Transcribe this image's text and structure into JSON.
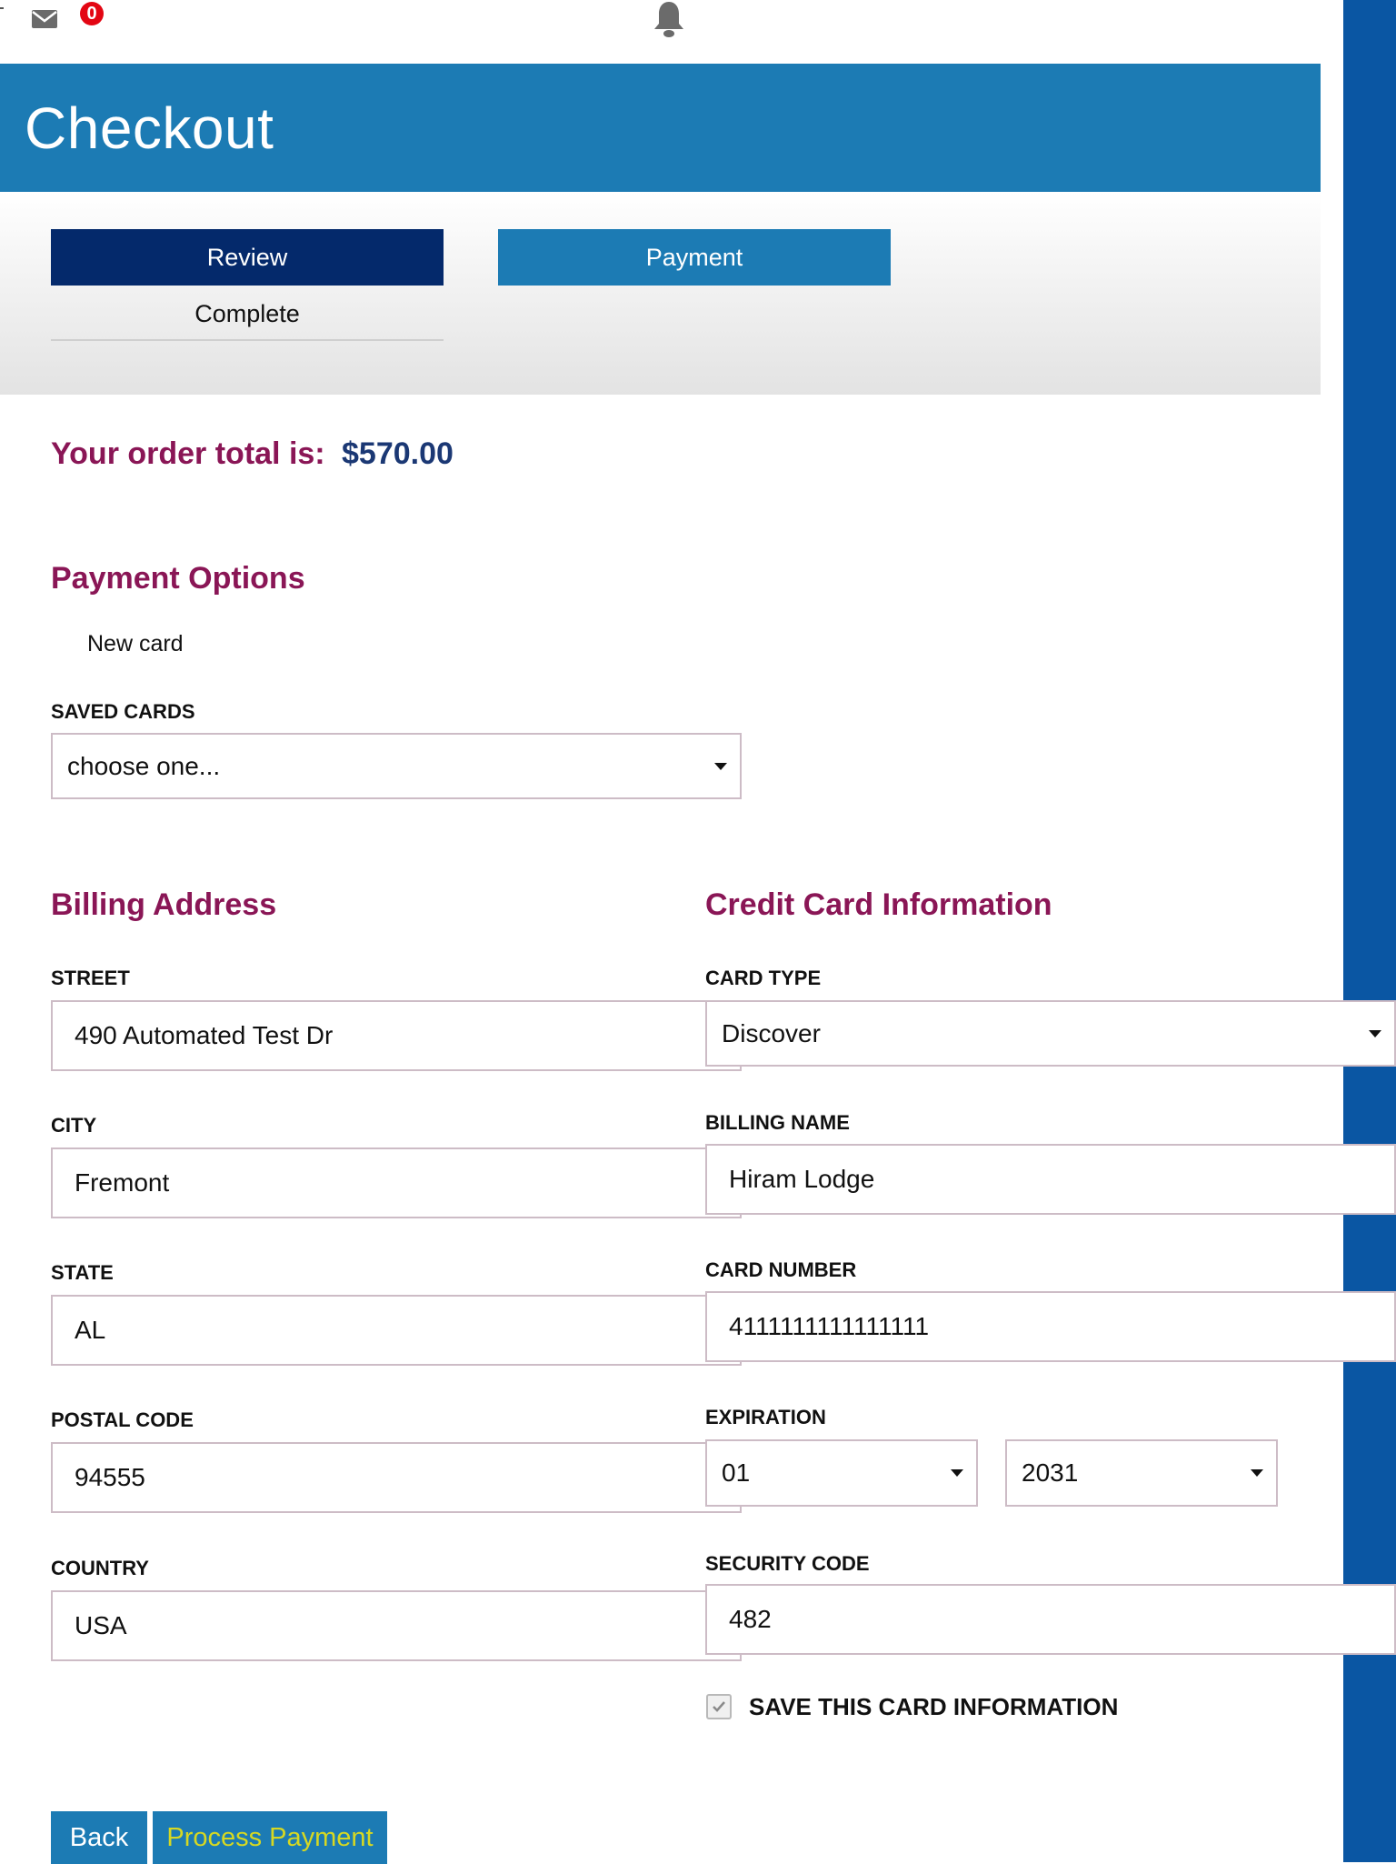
{
  "topbar": {
    "mail_icon": "mail-icon",
    "mail_badge": "0",
    "bell_icon": "bell-icon"
  },
  "header": {
    "title": "Checkout"
  },
  "steps": {
    "review": "Review",
    "payment": "Payment",
    "complete": "Complete"
  },
  "order": {
    "label": "Your order total is:",
    "total": "$570.00"
  },
  "payment_options": {
    "title": "Payment Options",
    "new_card": "New card",
    "saved_cards_label": "SAVED CARDS",
    "saved_cards_value": "choose one..."
  },
  "billing": {
    "title": "Billing Address",
    "street_label": "STREET",
    "street": "490 Automated Test Dr",
    "city_label": "CITY",
    "city": "Fremont",
    "state_label": "STATE",
    "state": "AL",
    "postal_label": "POSTAL CODE",
    "postal": "94555",
    "country_label": "COUNTRY",
    "country": "USA"
  },
  "card": {
    "title": "Credit Card Information",
    "type_label": "CARD TYPE",
    "type": "Discover",
    "name_label": "BILLING NAME",
    "name": "Hiram Lodge",
    "number_label": "CARD NUMBER",
    "number": "4111111111111111",
    "expiration_label": "EXPIRATION",
    "exp_month": "01",
    "exp_year": "2031",
    "security_label": "SECURITY CODE",
    "security": "482",
    "save_label": "SAVE THIS CARD INFORMATION",
    "save_checked": true
  },
  "buttons": {
    "back": "Back",
    "process": "Process Payment"
  },
  "colors": {
    "header": "#1c7bb4",
    "review_step": "#04296b",
    "section_title": "#8a1656",
    "total_value": "#1b3874",
    "right_bar": "#0a56a3",
    "process_text": "#d6d822"
  }
}
